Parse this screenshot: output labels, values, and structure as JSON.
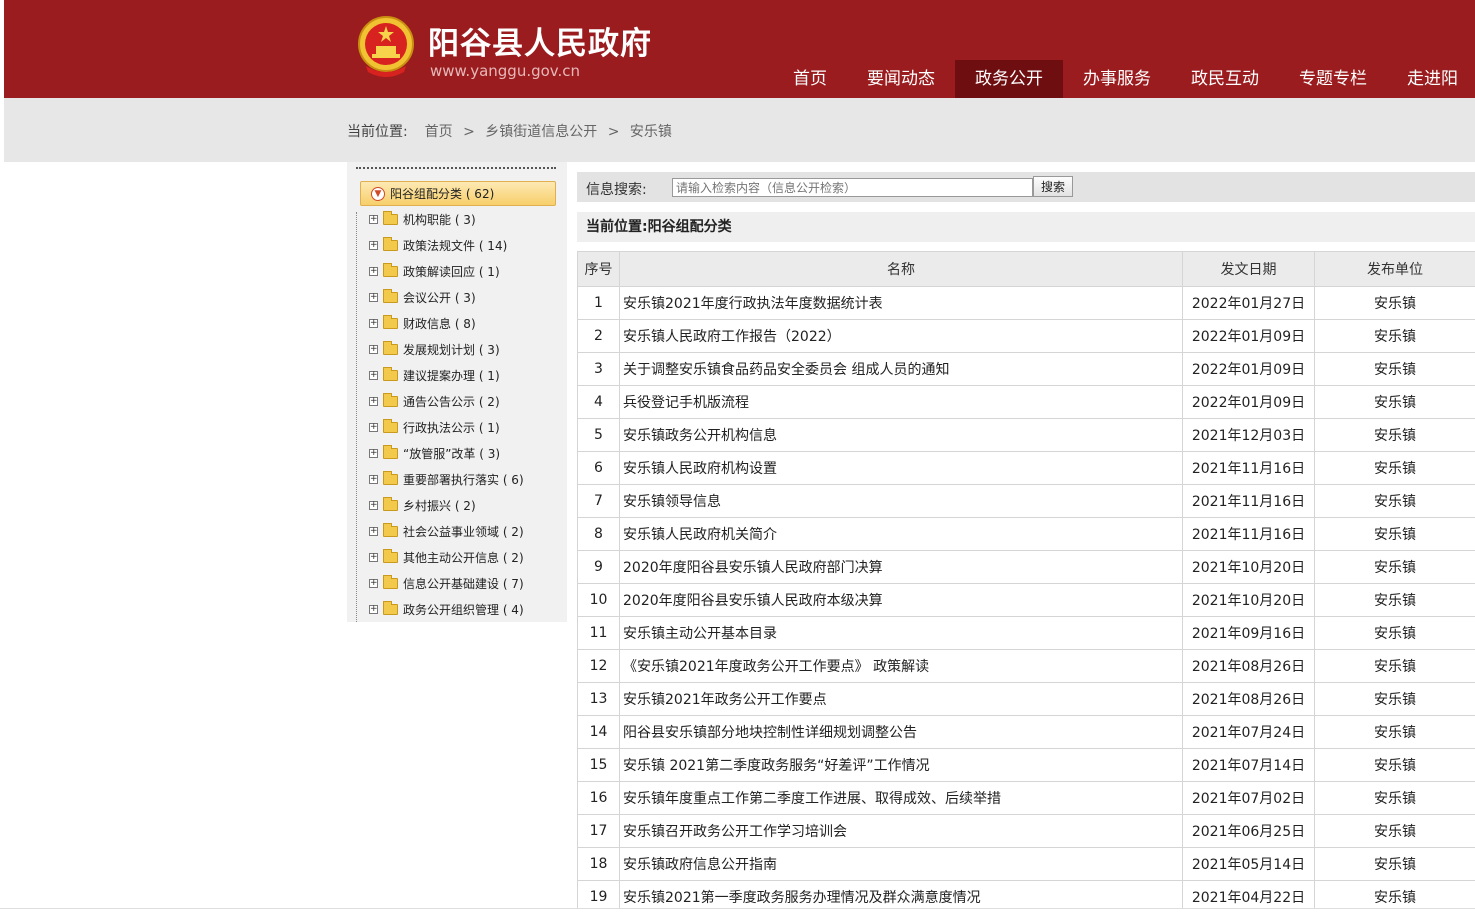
{
  "header": {
    "site_title": "阳谷县人民政府",
    "site_url": "www.yanggu.gov.cn",
    "nav": [
      "首页",
      "要闻动态",
      "政务公开",
      "办事服务",
      "政民互动",
      "专题专栏",
      "走进阳"
    ],
    "nav_active_index": 2
  },
  "breadcrumb": {
    "label": "当前位置:",
    "items": [
      "首页",
      "乡镇街道信息公开",
      "安乐镇"
    ],
    "separator": ">"
  },
  "sidebar": {
    "root": "阳谷组配分类 ( 62)",
    "items": [
      "机构职能 ( 3)",
      "政策法规文件 ( 14)",
      "政策解读回应 ( 1)",
      "会议公开 ( 3)",
      "财政信息 ( 8)",
      "发展规划计划 ( 3)",
      "建议提案办理 ( 1)",
      "通告公告公示 ( 2)",
      "行政执法公示 ( 1)",
      "“放管服”改革 ( 3)",
      "重要部署执行落实 ( 6)",
      "乡村振兴 ( 2)",
      "社会公益事业领域 ( 2)",
      "其他主动公开信息 ( 2)",
      "信息公开基础建设 ( 7)",
      "政务公开组织管理 ( 4)"
    ]
  },
  "search": {
    "label": "信息搜索:",
    "placeholder": "请输入检索内容（信息公开检索）",
    "button": "搜索"
  },
  "current": {
    "label": "当前位置:阳谷组配分类"
  },
  "table": {
    "headers": [
      "序号",
      "名称",
      "发文日期",
      "发布单位"
    ],
    "rows": [
      [
        "1",
        "安乐镇2021年度行政执法年度数据统计表",
        "2022年01月27日",
        "安乐镇"
      ],
      [
        "2",
        "安乐镇人民政府工作报告（2022）",
        "2022年01月09日",
        "安乐镇"
      ],
      [
        "3",
        "关于调整安乐镇食品药品安全委员会 组成人员的通知",
        "2022年01月09日",
        "安乐镇"
      ],
      [
        "4",
        "兵役登记手机版流程",
        "2022年01月09日",
        "安乐镇"
      ],
      [
        "5",
        "安乐镇政务公开机构信息",
        "2021年12月03日",
        "安乐镇"
      ],
      [
        "6",
        "安乐镇人民政府机构设置",
        "2021年11月16日",
        "安乐镇"
      ],
      [
        "7",
        "安乐镇领导信息",
        "2021年11月16日",
        "安乐镇"
      ],
      [
        "8",
        "安乐镇人民政府机关简介",
        "2021年11月16日",
        "安乐镇"
      ],
      [
        "9",
        "2020年度阳谷县安乐镇人民政府部门决算",
        "2021年10月20日",
        "安乐镇"
      ],
      [
        "10",
        "2020年度阳谷县安乐镇人民政府本级决算",
        "2021年10月20日",
        "安乐镇"
      ],
      [
        "11",
        "安乐镇主动公开基本目录",
        "2021年09月16日",
        "安乐镇"
      ],
      [
        "12",
        "《安乐镇2021年度政务公开工作要点》 政策解读",
        "2021年08月26日",
        "安乐镇"
      ],
      [
        "13",
        "安乐镇2021年政务公开工作要点",
        "2021年08月26日",
        "安乐镇"
      ],
      [
        "14",
        "阳谷县安乐镇部分地块控制性详细规划调整公告",
        "2021年07月24日",
        "安乐镇"
      ],
      [
        "15",
        "安乐镇 2021第二季度政务服务“好差评”工作情况",
        "2021年07月14日",
        "安乐镇"
      ],
      [
        "16",
        "安乐镇年度重点工作第二季度工作进展、取得成效、后续举措",
        "2021年07月02日",
        "安乐镇"
      ],
      [
        "17",
        "安乐镇召开政务公开工作学习培训会",
        "2021年06月25日",
        "安乐镇"
      ],
      [
        "18",
        "安乐镇政府信息公开指南",
        "2021年05月14日",
        "安乐镇"
      ],
      [
        "19",
        "安乐镇2021第一季度政务服务办理情况及群众满意度情况",
        "2021年04月22日",
        "安乐镇"
      ]
    ]
  },
  "colors": {
    "header_red": "#9b1c1f",
    "nav_active": "#6e0e10",
    "tree_root_bg": "#f7cf6a"
  }
}
